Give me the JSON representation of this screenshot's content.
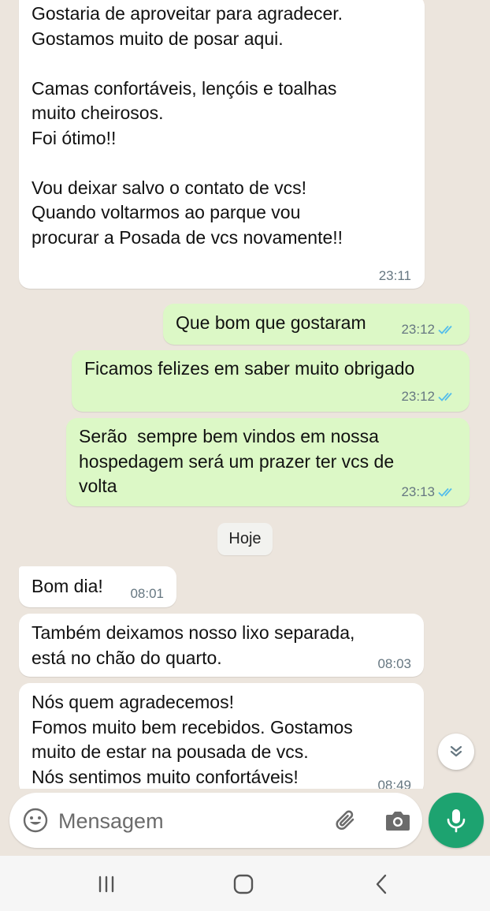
{
  "messages": [
    {
      "direction": "in",
      "text": "Gostaria de aproveitar para agradecer.\nGostamos muito de posar aqui.\n\nCamas confortáveis, lençóis e toalhas\nmuito cheirosos.\nFoi ótimo!!\n\nVou deixar salvo o contato de vcs!\nQuando voltarmos ao parque vou\nprocurar a Posada de vcs novamente!!",
      "time": "23:11"
    },
    {
      "direction": "out",
      "text": "Que bom que gostaram",
      "time": "23:12"
    },
    {
      "direction": "out",
      "text": "Ficamos felizes em saber muito obrigado",
      "time": "23:12"
    },
    {
      "direction": "out",
      "text": "Serão  sempre bem vindos em nossa\nhospedagem será um prazer ter vcs de\nvolta",
      "time": "23:13"
    },
    {
      "direction": "in",
      "text": "Bom dia!",
      "time": "08:01"
    },
    {
      "direction": "in",
      "text": "Também deixamos nosso lixo separada,\nestá no chão do quarto.",
      "time": "08:03"
    },
    {
      "direction": "in",
      "text": "Nós quem agradecemos!\nFomos muito bem recebidos. Gostamos\nmuito de estar na pousada de vcs.\nNós sentimos muito confortáveis!",
      "time": "08:49"
    }
  ],
  "date_separator": "Hoje",
  "composer": {
    "placeholder": "Mensagem"
  },
  "icons": {
    "emoji": "emoji-icon",
    "attach": "paperclip-icon",
    "camera": "camera-icon",
    "mic": "microphone-icon",
    "scroll": "double-chevron-down-icon",
    "read_ticks": "double-check-icon",
    "nav": [
      "recents-icon",
      "home-icon",
      "back-icon"
    ]
  },
  "colors": {
    "incoming": "#ffffff",
    "outgoing": "#dcf8c6",
    "mic": "#1da370",
    "read_ticks": "#53bdeb",
    "background": "#ece5dd"
  }
}
